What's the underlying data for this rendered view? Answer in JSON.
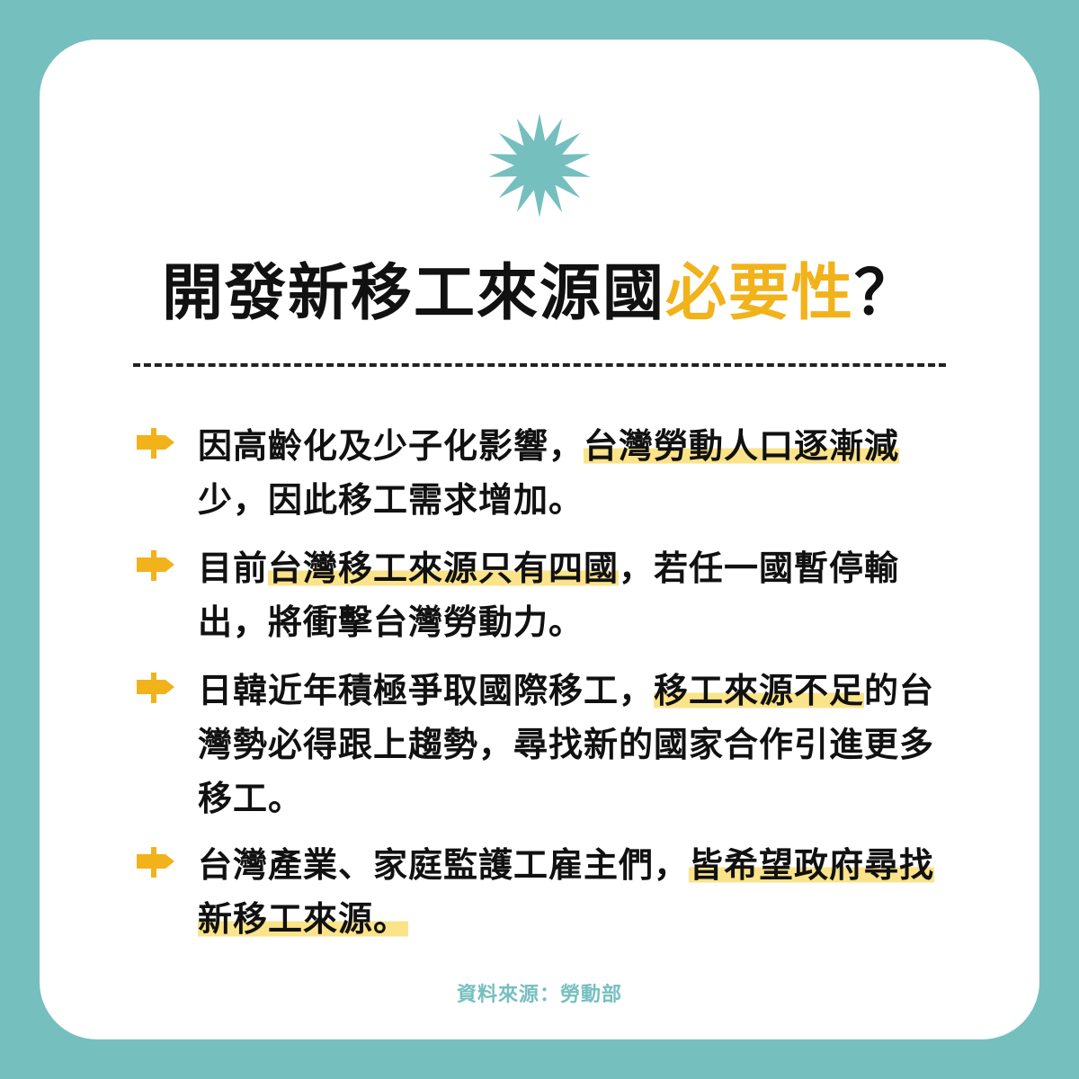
{
  "title": {
    "main": "開發新移工來源國",
    "highlight": "必要性",
    "end": "？"
  },
  "colors": {
    "background": "#76bfbf",
    "card": "#ffffff",
    "accent": "#f2b21a",
    "highlight": "#fbe38a",
    "text": "#111111"
  },
  "icons": {
    "header": "starburst-icon",
    "bullet": "signpost-arrow-icon"
  },
  "items": [
    {
      "parts": [
        "因高齡化及少子化影響，",
        "台灣勞動人口逐漸減",
        "少，因此移工需求增加。"
      ]
    },
    {
      "parts": [
        "目前",
        "台灣移工來源只有四國",
        "，若任一國暫停輸出，將衝擊台灣勞動力。"
      ]
    },
    {
      "parts": [
        "日韓近年積極爭取國際移工，",
        "移工來源不足",
        "的台灣勢必得跟上趨勢，尋找新的國家合作引進更多移工。"
      ]
    },
    {
      "parts": [
        "台灣產業、家庭監護工雇主們，",
        "皆希望政府尋找新移工來源。",
        ""
      ]
    }
  ],
  "source": "資料來源：勞動部"
}
